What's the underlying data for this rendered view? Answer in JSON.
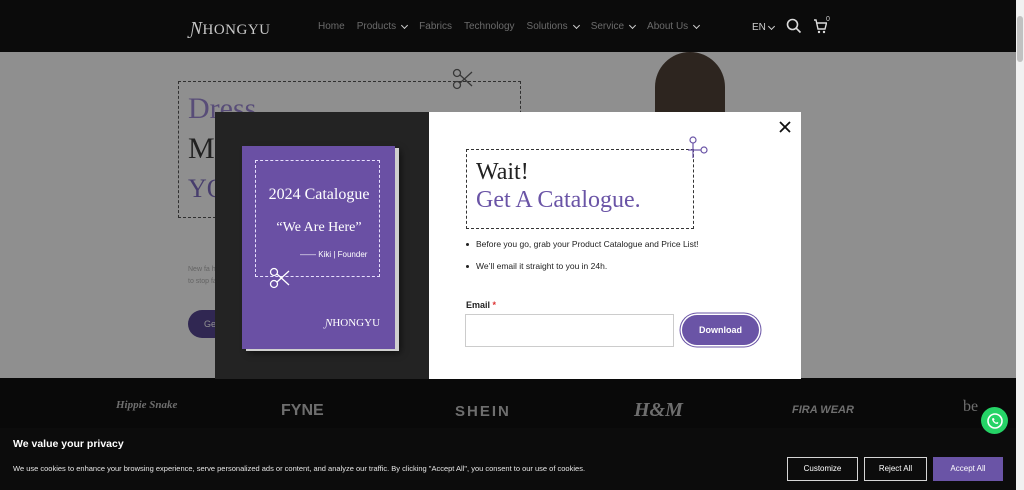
{
  "header": {
    "logo": "HONGYU",
    "nav": [
      {
        "label": "Home",
        "dropdown": false
      },
      {
        "label": "Products",
        "dropdown": true
      },
      {
        "label": "Fabrics",
        "dropdown": false
      },
      {
        "label": "Technology",
        "dropdown": false
      },
      {
        "label": "Solutions",
        "dropdown": true
      },
      {
        "label": "Service",
        "dropdown": true
      },
      {
        "label": "About Us",
        "dropdown": true
      }
    ],
    "language": "EN",
    "cart_count": "0"
  },
  "hero": {
    "line1": "Dress",
    "line2": "M",
    "line3": "YO",
    "text": "New fa here to stop fa",
    "button": "Ge"
  },
  "brands": [
    "Hippie Snake",
    "FYNE",
    "SHEIN",
    "H&M",
    "FIRA WEAR",
    "be"
  ],
  "modal": {
    "book": {
      "title": "2024 Catalogue",
      "quote": "“We Are Here”",
      "signature": "—— Kiki | Founder",
      "logo": "HONGYU"
    },
    "heading1": "Wait!",
    "heading2": "Get A Catalogue.",
    "bullets": [
      "Before you go, grab your Product Catalogue and Price List!",
      "We’ll email it straight to you in 24h."
    ],
    "email_label": "Email",
    "email_required": "*",
    "email_value": "",
    "download_button": "Download"
  },
  "cookie": {
    "title": "We value your privacy",
    "text": "We use cookies to enhance your browsing experience, serve personalized ads or content, and analyze our traffic. By clicking \"Accept All\", you consent to our use of cookies.",
    "customize": "Customize",
    "reject": "Reject All",
    "accept": "Accept All"
  },
  "colors": {
    "accent": "#6a54a6",
    "header_bg": "#0b0b0b",
    "whatsapp": "#25d366"
  }
}
